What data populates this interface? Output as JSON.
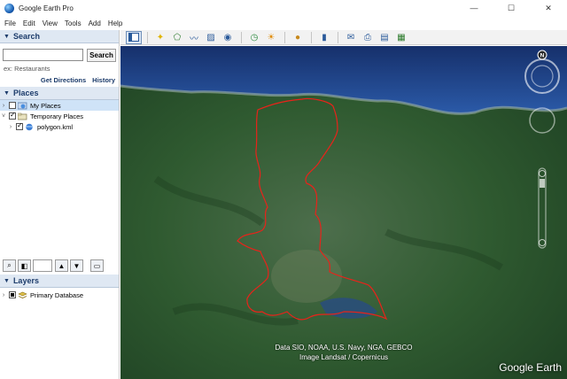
{
  "window": {
    "title": "Google Earth Pro",
    "minimize_glyph": "—",
    "maximize_glyph": "☐",
    "close_glyph": "✕"
  },
  "menu": [
    "File",
    "Edit",
    "View",
    "Tools",
    "Add",
    "Help"
  ],
  "search": {
    "header": "Search",
    "input_value": "",
    "button_label": "Search",
    "hint": "ex: Restaurants",
    "get_directions": "Get Directions",
    "history": "History"
  },
  "places": {
    "header": "Places",
    "items": [
      {
        "label": "My Places",
        "checked": false,
        "selected": true
      },
      {
        "label": "Temporary Places",
        "checked": true
      },
      {
        "label": "polygon.kml",
        "checked": true
      }
    ]
  },
  "layers": {
    "header": "Layers",
    "items": [
      {
        "label": "Primary Database"
      }
    ]
  },
  "map": {
    "attribution_line1": "Data SIO, NOAA, U.S. Navy, NGA, GEBCO",
    "attribution_line2": "Image Landsat / Copernicus",
    "logo": "Google Earth",
    "compass_north": "N",
    "boundary_color": "#e8231a",
    "sea_color": "#1f3f86",
    "land_color": "#2e5a2e"
  }
}
